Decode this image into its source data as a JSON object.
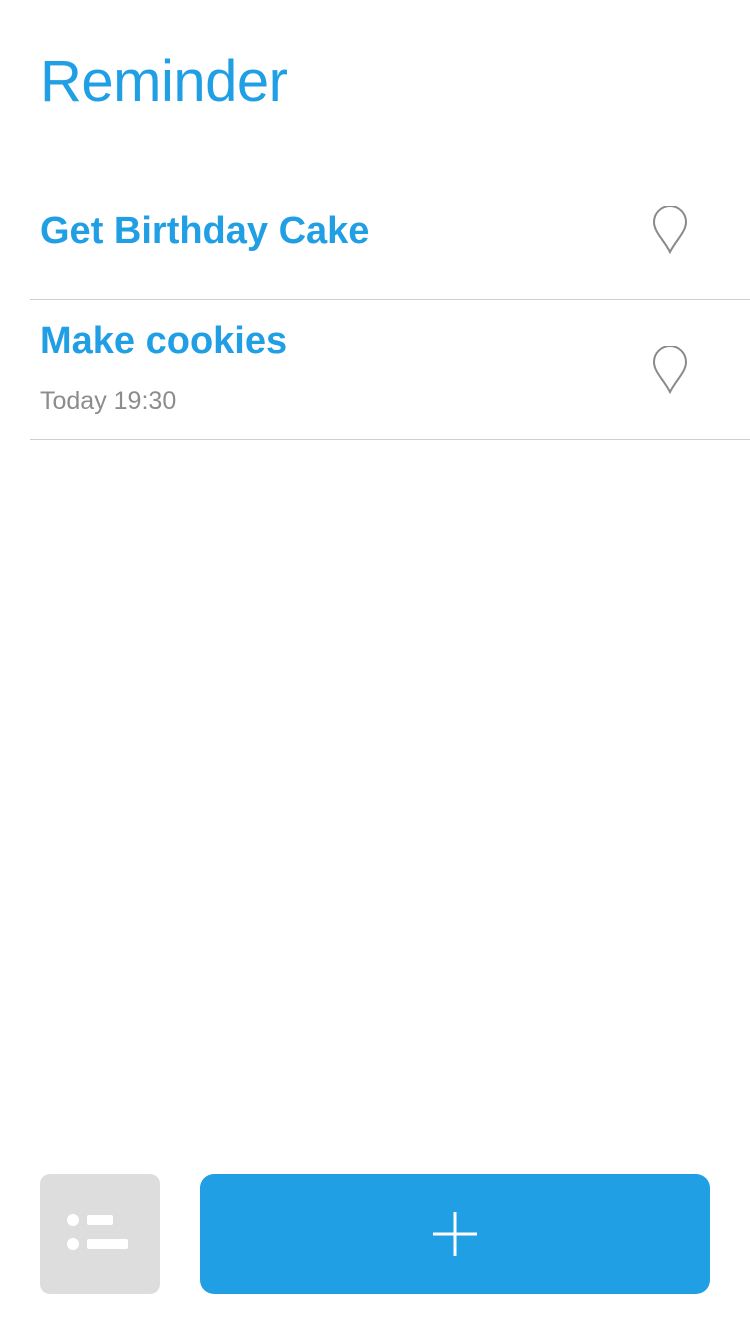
{
  "colors": {
    "accent": "#219FE4",
    "background": "#FFFFFF",
    "secondary_text": "#8C8C8C",
    "divider": "#CFCFCF",
    "list_button_bg": "#DDDDDD",
    "pin_stroke": "#8A8A8A"
  },
  "header": {
    "title": "Reminder"
  },
  "reminders": [
    {
      "title": "Get Birthday Cake",
      "time": "",
      "icon": "location-pin-icon"
    },
    {
      "title": "Make cookies",
      "time": "Today 19:30",
      "icon": "location-pin-icon"
    }
  ],
  "footer": {
    "list_button_icon": "list-icon",
    "add_button_icon": "plus-icon"
  }
}
